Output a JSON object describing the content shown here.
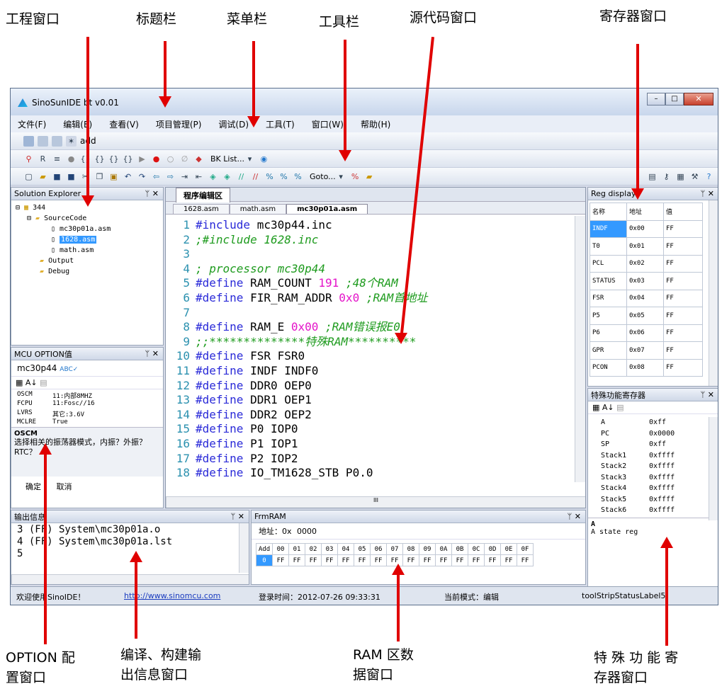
{
  "captions": {
    "project_window": "工程窗口",
    "title_bar": "标题栏",
    "menu_bar": "菜单栏",
    "toolbar": "工具栏",
    "source_window": "源代码窗口",
    "register_window": "寄存器窗口",
    "option_window_1": "OPTION 配",
    "option_window_2": "置窗口",
    "output_window_1": "编译、构建输",
    "output_window_2": "出信息窗口",
    "ram_window_1": "RAM  区数",
    "ram_window_2": "据窗口",
    "sfr_window_1": "特 殊 功 能 寄",
    "sfr_window_2": "存器窗口"
  },
  "window": {
    "title": "SinoSunIDE bt v0.01"
  },
  "menu": [
    "文件(F)",
    "编辑(E)",
    "查看(V)",
    "项目管理(P)",
    "调试(D)",
    "工具(T)",
    "窗口(W)",
    "帮助(H)"
  ],
  "toolbar": {
    "add_label": "add",
    "bk_list": "BK List...",
    "goto": "Goto..."
  },
  "solution_explorer": {
    "title": "Solution Explorer",
    "items": [
      "344",
      "SourceCode",
      "mc30p01a.asm",
      "1628.asm",
      "math.asm",
      "Output",
      "Debug"
    ]
  },
  "mcu_option": {
    "title": "MCU OPTION值",
    "chip": "mc30p44",
    "rows": [
      [
        "OSCM",
        "11:内部8MHZ"
      ],
      [
        "FCPU",
        "11:Fosc//16"
      ],
      [
        "LVRS",
        "其它:3.6V"
      ],
      [
        "MCLRE",
        "True"
      ]
    ],
    "desc_title": "OSCM",
    "desc_text": "选择相关的振荡器模式，内振？外振？RTC？",
    "ok": "确定",
    "cancel": "取消"
  },
  "editor": {
    "region_tab": "程序编辑区",
    "file_tabs": [
      "1628.asm",
      "math.asm",
      "mc30p01a.asm"
    ],
    "lines": [
      {
        "n": "1",
        "kw": "#include",
        "a": " mc30p44.inc",
        "num": "",
        "cm": ""
      },
      {
        "n": "2",
        "kw": "",
        "a": "",
        "num": "",
        "cm": ";#include 1628.inc"
      },
      {
        "n": "3",
        "kw": "",
        "a": "",
        "num": "",
        "cm": ""
      },
      {
        "n": "4",
        "kw": "",
        "a": "",
        "num": "",
        "cm": "; processor mc30p44"
      },
      {
        "n": "5",
        "kw": "#define",
        "a": " RAM_COUNT ",
        "num": "191",
        "cm": " ;48个RAM"
      },
      {
        "n": "6",
        "kw": "#define",
        "a": " FIR_RAM_ADDR ",
        "num": "0x0",
        "cm": "   ;RAM首地址"
      },
      {
        "n": "7",
        "kw": "",
        "a": "",
        "num": "",
        "cm": ""
      },
      {
        "n": "8",
        "kw": "#define",
        "a": " RAM_E ",
        "num": "0x00",
        "cm": "   ;RAM错误报E0"
      },
      {
        "n": "9",
        "kw": "",
        "a": "",
        "num": "",
        "cm": ";;**************特殊RAM**********"
      },
      {
        "n": "10",
        "kw": "#define",
        "a": " FSR FSR0",
        "num": "",
        "cm": ""
      },
      {
        "n": "11",
        "kw": "#define",
        "a": " INDF INDF0",
        "num": "",
        "cm": ""
      },
      {
        "n": "12",
        "kw": "#define",
        "a": " DDR0 OEP0",
        "num": "",
        "cm": ""
      },
      {
        "n": "13",
        "kw": "#define",
        "a": " DDR1 OEP1",
        "num": "",
        "cm": ""
      },
      {
        "n": "14",
        "kw": "#define",
        "a": " DDR2 OEP2",
        "num": "",
        "cm": ""
      },
      {
        "n": "15",
        "kw": "#define",
        "a": " P0 IOP0",
        "num": "",
        "cm": ""
      },
      {
        "n": "16",
        "kw": "#define",
        "a": " P1 IOP1",
        "num": "",
        "cm": ""
      },
      {
        "n": "17",
        "kw": "#define",
        "a": " P2 IOP2",
        "num": "",
        "cm": ""
      },
      {
        "n": "18",
        "kw": "#define",
        "a": " IO_TM1628_STB P0.0",
        "num": "",
        "cm": ""
      }
    ],
    "scroll_label": "III"
  },
  "reg_display": {
    "title": "Reg display",
    "headers": [
      "名称",
      "地址",
      "值"
    ],
    "rows": [
      [
        "INDF",
        "0x00",
        "FF"
      ],
      [
        "T0",
        "0x01",
        "FF"
      ],
      [
        "PCL",
        "0x02",
        "FF"
      ],
      [
        "STATUS",
        "0x03",
        "FF"
      ],
      [
        "FSR",
        "0x04",
        "FF"
      ],
      [
        "P5",
        "0x05",
        "FF"
      ],
      [
        "P6",
        "0x06",
        "FF"
      ],
      [
        "GPR",
        "0x07",
        "FF"
      ],
      [
        "PCON",
        "0x08",
        "FF"
      ]
    ]
  },
  "sfr": {
    "title": "特殊功能寄存器",
    "rows": [
      [
        "A",
        "0xff"
      ],
      [
        "PC",
        "0x0000"
      ],
      [
        "SP",
        "0xff"
      ],
      [
        "Stack1",
        "0xffff"
      ],
      [
        "Stack2",
        "0xffff"
      ],
      [
        "Stack3",
        "0xffff"
      ],
      [
        "Stack4",
        "0xffff"
      ],
      [
        "Stack5",
        "0xffff"
      ],
      [
        "Stack6",
        "0xffff"
      ]
    ],
    "desc_title": "A",
    "desc_text": "A state reg"
  },
  "output": {
    "title": "输出信息",
    "lines": [
      "3  (FF) System\\mc30p01a.o",
      "4  (FF) System\\mc30p01a.lst",
      "5"
    ]
  },
  "ram": {
    "title": "FrmRAM",
    "addr_label": "地址：0x",
    "addr_value": "0000",
    "headers": [
      "Add",
      "00",
      "01",
      "02",
      "03",
      "04",
      "05",
      "06",
      "07",
      "08",
      "09",
      "0A",
      "0B",
      "0C",
      "0D",
      "0E",
      "0F"
    ],
    "row": [
      "0",
      "FF",
      "FF",
      "FF",
      "FF",
      "FF",
      "FF",
      "FF",
      "FF",
      "FF",
      "FF",
      "FF",
      "FF",
      "FF",
      "FF",
      "FF",
      "FF"
    ]
  },
  "statusbar": {
    "welcome": "欢迎使用SinoIDE！",
    "link": "http://www.sinomcu.com",
    "login": "登录时间：2012-07-26 09:33:31",
    "mode": "当前模式：编辑",
    "label5": "toolStripStatusLabel5"
  }
}
